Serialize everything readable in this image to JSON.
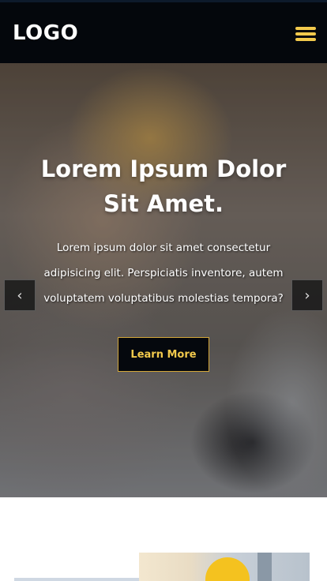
{
  "header": {
    "logo": "LOGO",
    "menu_icon": "hamburger-menu-icon",
    "accent_color": "#f2c94c"
  },
  "hero": {
    "title": "Lorem Ipsum Dolor Sit Amet.",
    "text": "Lorem ipsum dolor sit amet consectetur adipisicing elit. Perspiciatis inventore, autem voluptatem voluptatibus molestias tempora?",
    "cta_label": "Learn More",
    "prev_icon": "chevron-left-icon",
    "next_icon": "chevron-right-icon",
    "prev_glyph": "‹",
    "next_glyph": "›"
  }
}
